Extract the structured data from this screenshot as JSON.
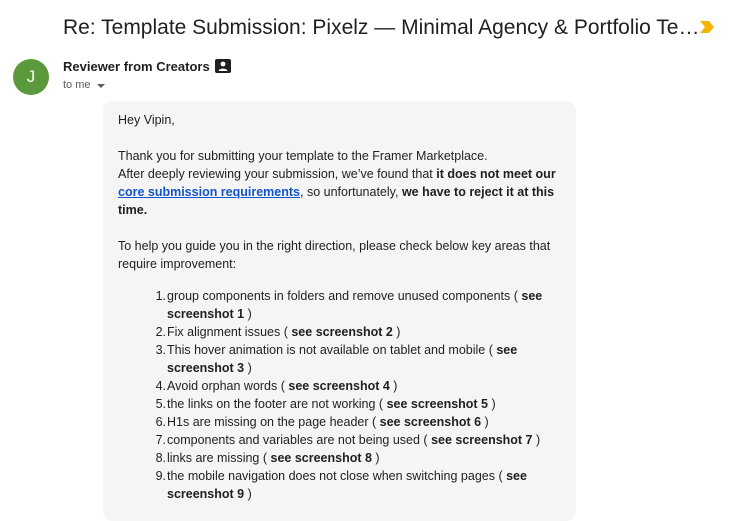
{
  "email": {
    "subject": "Re: Template Submission: Pixelz — Minimal Agency & Portfolio Template for Framer",
    "sender": {
      "initial": "J",
      "name": "Reviewer from Creators",
      "recipient": "to me"
    },
    "body": {
      "greeting": "Hey Vipin,",
      "intro": "Thank you for submitting your template to the Framer Marketplace.",
      "review_before": "After deeply reviewing your submission, we’ve found that ",
      "review_bold": "it does not meet our",
      "link": "core submission requirements",
      "review_after": ", so unfortunately, ",
      "reject_bold": "we have to reject it at this time.",
      "guide": "To help you guide you in the right direction, please check below key areas that require improvement:",
      "items": [
        {
          "num": "1.",
          "text": "group components in folders and remove unused components ( ",
          "ref": "see screenshot 1",
          "close": " )"
        },
        {
          "num": "2.",
          "text": "Fix alignment issues ( ",
          "ref": "see screenshot 2",
          "close": " )"
        },
        {
          "num": "3.",
          "text": "This hover animation is not available on tablet and mobile ( ",
          "ref": "see screenshot 3",
          "close": " )"
        },
        {
          "num": "4.",
          "text": "Avoid orphan words ( ",
          "ref": "see screenshot 4",
          "close": " )"
        },
        {
          "num": "5.",
          "text": "the links on the footer are not working ( ",
          "ref": "see screenshot 5",
          "close": " )"
        },
        {
          "num": "6.",
          "text": "H1s are missing on the page header ( ",
          "ref": "see screenshot 6",
          "close": " )"
        },
        {
          "num": "7.",
          "text": "components and variables are not being used ( ",
          "ref": "see screenshot 7",
          "close": " )"
        },
        {
          "num": "8.",
          "text": "links are missing ( ",
          "ref": "see screenshot 8",
          "close": " )"
        },
        {
          "num": "9.",
          "text": "the mobile navigation does not close when switching pages ( ",
          "ref": "see screenshot 9",
          "close": " )"
        }
      ]
    }
  },
  "icons": {
    "important": "important-marker-icon",
    "badge": "contact-card-icon",
    "recipient_toggle": "chevron-down-icon"
  },
  "colors": {
    "avatar": "#5a9a3c",
    "important": "#f4b400",
    "link": "#1155cc",
    "card_bg": "#f5f5f5"
  }
}
